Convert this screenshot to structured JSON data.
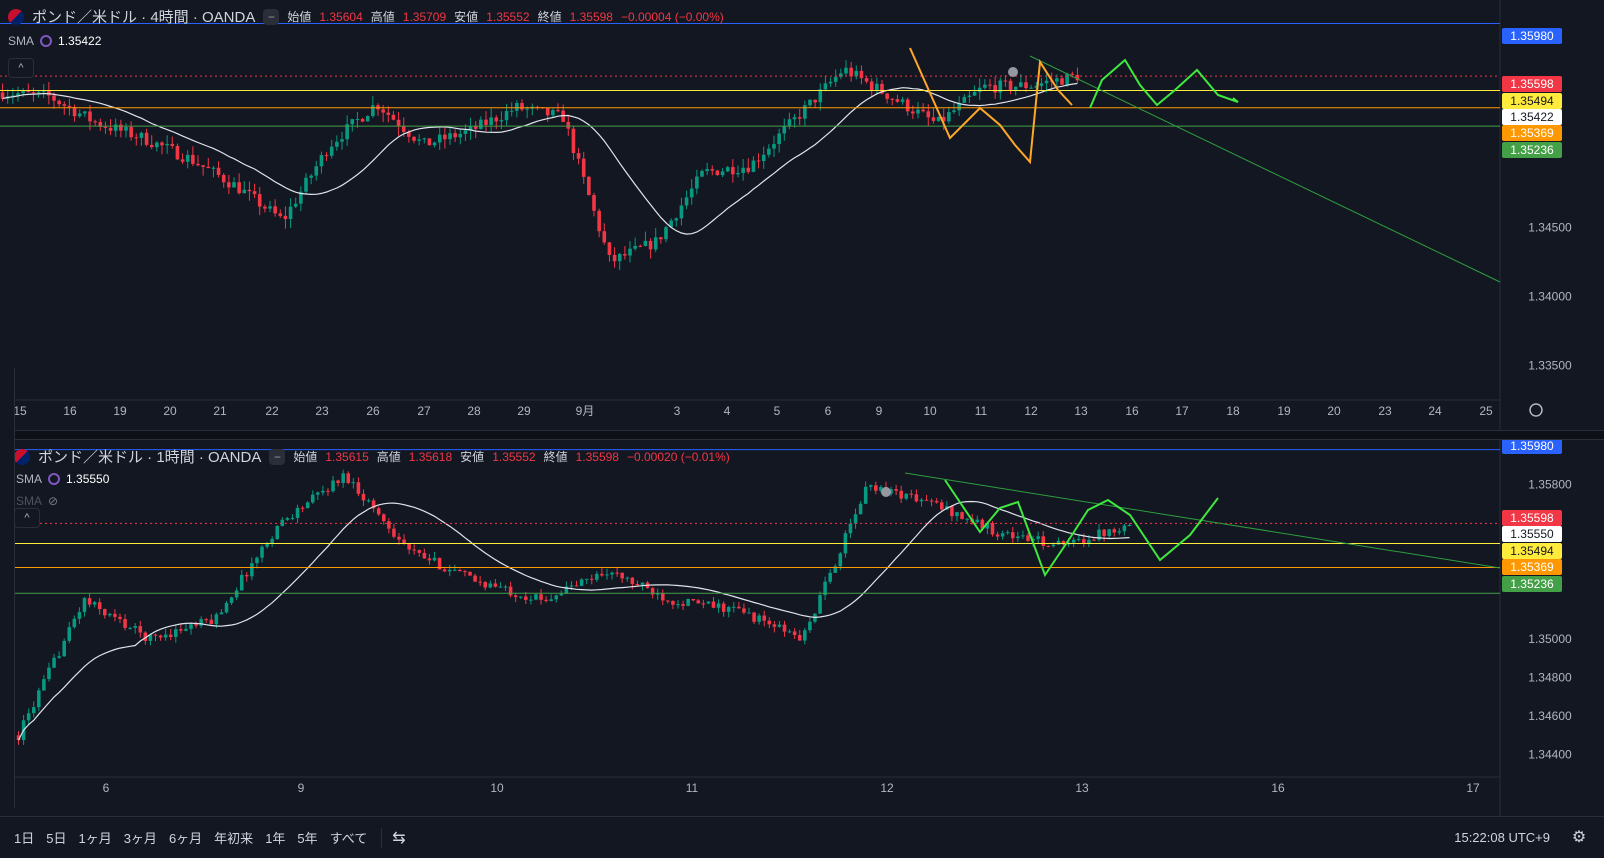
{
  "pane1": {
    "symbol": "ポンド／米ドル · 4時間 · OANDA",
    "open_label": "始値",
    "open": "1.35604",
    "high_label": "高値",
    "high": "1.35709",
    "low_label": "安値",
    "low": "1.35552",
    "close_label": "終値",
    "close": "1.35598",
    "change": "−0.00004 (−0.00%)",
    "sma_label": "SMA",
    "sma_value": "1.35422",
    "price_range": [
      1.3325,
      1.3615
    ],
    "y_ticks": [
      "1.34500",
      "1.34000",
      "1.33500"
    ],
    "y_tick_values": [
      1.345,
      1.34,
      1.335
    ],
    "x_labels": [
      "15",
      "16",
      "19",
      "20",
      "21",
      "22",
      "23",
      "26",
      "27",
      "28",
      "29",
      "9月",
      "3",
      "4",
      "5",
      "6",
      "9",
      "10",
      "11",
      "12",
      "13",
      "16",
      "17",
      "18",
      "19",
      "20",
      "23",
      "24",
      "25"
    ],
    "h_lines": [
      {
        "label": "1.35980",
        "value": 1.3598,
        "color": "#2962ff"
      },
      {
        "label": "1.35598",
        "value": 1.35598,
        "color": "#f23645"
      },
      {
        "label": "1.35494",
        "value": 1.35494,
        "color": "#ffeb3b"
      },
      {
        "label": "1.35422",
        "value": 1.35422,
        "color": "#ffffff"
      },
      {
        "label": "1.35369",
        "value": 1.35369,
        "color": "#ff9800"
      },
      {
        "label": "1.35236",
        "value": 1.35236,
        "color": "#43a047"
      }
    ]
  },
  "pane2": {
    "symbol": "ポンド／米ドル · 1時間 · OANDA",
    "open_label": "始値",
    "open": "1.35615",
    "high_label": "高値",
    "high": "1.35618",
    "low_label": "安値",
    "low": "1.35552",
    "close_label": "終値",
    "close": "1.35598",
    "change": "−0.00020 (−0.01%)",
    "sma_label": "SMA",
    "sma_value": "1.35550",
    "sma2_label": "SMA",
    "price_range": [
      1.3432,
      1.3603
    ],
    "y_ticks": [
      "1.35800",
      "1.35000",
      "1.34800",
      "1.34600",
      "1.34400"
    ],
    "y_tick_values": [
      1.358,
      1.35,
      1.348,
      1.346,
      1.344
    ],
    "x_labels": [
      "6",
      "9",
      "10",
      "11",
      "12",
      "13",
      "16",
      "17"
    ],
    "h_lines": [
      {
        "label": "1.35980",
        "value": 1.3598,
        "color": "#2962ff"
      },
      {
        "label": "1.35598",
        "value": 1.35598,
        "color": "#f23645"
      },
      {
        "label": "1.35550",
        "value": 1.3555,
        "color": "#ffffff"
      },
      {
        "label": "1.35494",
        "value": 1.35494,
        "color": "#ffeb3b"
      },
      {
        "label": "1.35369",
        "value": 1.35369,
        "color": "#ff9800"
      },
      {
        "label": "1.35236",
        "value": 1.35236,
        "color": "#43a047"
      }
    ]
  },
  "bottom_bar": {
    "ranges": [
      "1日",
      "5日",
      "1ヶ月",
      "3ヶ月",
      "6ヶ月",
      "年初来",
      "1年",
      "5年",
      "すべて"
    ],
    "time": "15:22:08 UTC+9"
  },
  "colors": {
    "up": "#089981",
    "down": "#f23645",
    "background": "#131722",
    "sma": "#e0e3eb",
    "forecast": "#3ee83e",
    "zigzag": "#ffa726"
  },
  "chart_data": [
    {
      "type": "candlestick",
      "title": "ポンド／米ドル · 4時間 · OANDA",
      "timeframe": "4H",
      "ylim": [
        1.3325,
        1.3615
      ],
      "x": [
        "15",
        "16",
        "19",
        "20",
        "21",
        "22",
        "23",
        "26",
        "27",
        "28",
        "29",
        "9月",
        "3",
        "4",
        "5",
        "6",
        "9",
        "10",
        "11",
        "12",
        "13"
      ],
      "close": [
        1.3548,
        1.3545,
        1.3526,
        1.3515,
        1.35,
        1.348,
        1.3455,
        1.351,
        1.354,
        1.351,
        1.352,
        1.3537,
        1.353,
        1.3425,
        1.344,
        1.349,
        1.3495,
        1.353,
        1.3565,
        1.3545,
        1.3525,
        1.3552,
        1.3553,
        1.356
      ],
      "sma_last": 1.35422
    },
    {
      "type": "candlestick",
      "title": "ポンド／米ドル · 1時間 · OANDA",
      "timeframe": "1H",
      "ylim": [
        1.3432,
        1.3603
      ],
      "x": [
        "6",
        "9",
        "10",
        "11",
        "12",
        "13"
      ],
      "close": [
        1.345,
        1.352,
        1.35,
        1.351,
        1.356,
        1.3585,
        1.3545,
        1.353,
        1.352,
        1.3535,
        1.352,
        1.3515,
        1.35,
        1.358,
        1.357,
        1.3555,
        1.3548,
        1.356
      ],
      "sma_last": 1.3555
    }
  ]
}
